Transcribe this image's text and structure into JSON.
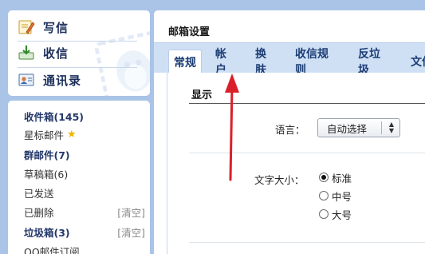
{
  "compose": {
    "write_label": "写信",
    "receive_label": "收信",
    "contacts_label": "通讯录"
  },
  "folders": {
    "inbox": "收件箱(145)",
    "starred": "星标邮件",
    "group": "群邮件(7)",
    "drafts": "草稿箱(6)",
    "sent": "已发送",
    "deleted": "已删除",
    "deleted_clear": "[清空]",
    "spam": "垃圾箱(3)",
    "spam_clear": "[清空]",
    "subscriptions": "QQ邮件订阅"
  },
  "settings": {
    "title": "邮箱设置",
    "tabs": [
      "常规",
      "帐户",
      "换肤",
      "收信规则",
      "反垃圾",
      "文件"
    ],
    "active_tab": "常规",
    "section_display": "显示",
    "language_label": "语言：",
    "language_value": "自动选择",
    "font_size_label": "文字大小：",
    "font_size_options": [
      "标准",
      "中号",
      "大号"
    ],
    "font_size_selected": "标准"
  },
  "annotation": {
    "arrow_color": "#d9202a",
    "arrow_target": "帐户"
  },
  "icons": {
    "write": "pencil-note-icon",
    "receive": "inbox-download-icon",
    "contacts": "contact-card-icon",
    "star": "star-icon",
    "watermark": "qq-penguin-stamp-icon"
  },
  "colors": {
    "background": "#a9c4e6",
    "tabbar": "#cfe0f5",
    "accent_text": "#1c3d74"
  }
}
